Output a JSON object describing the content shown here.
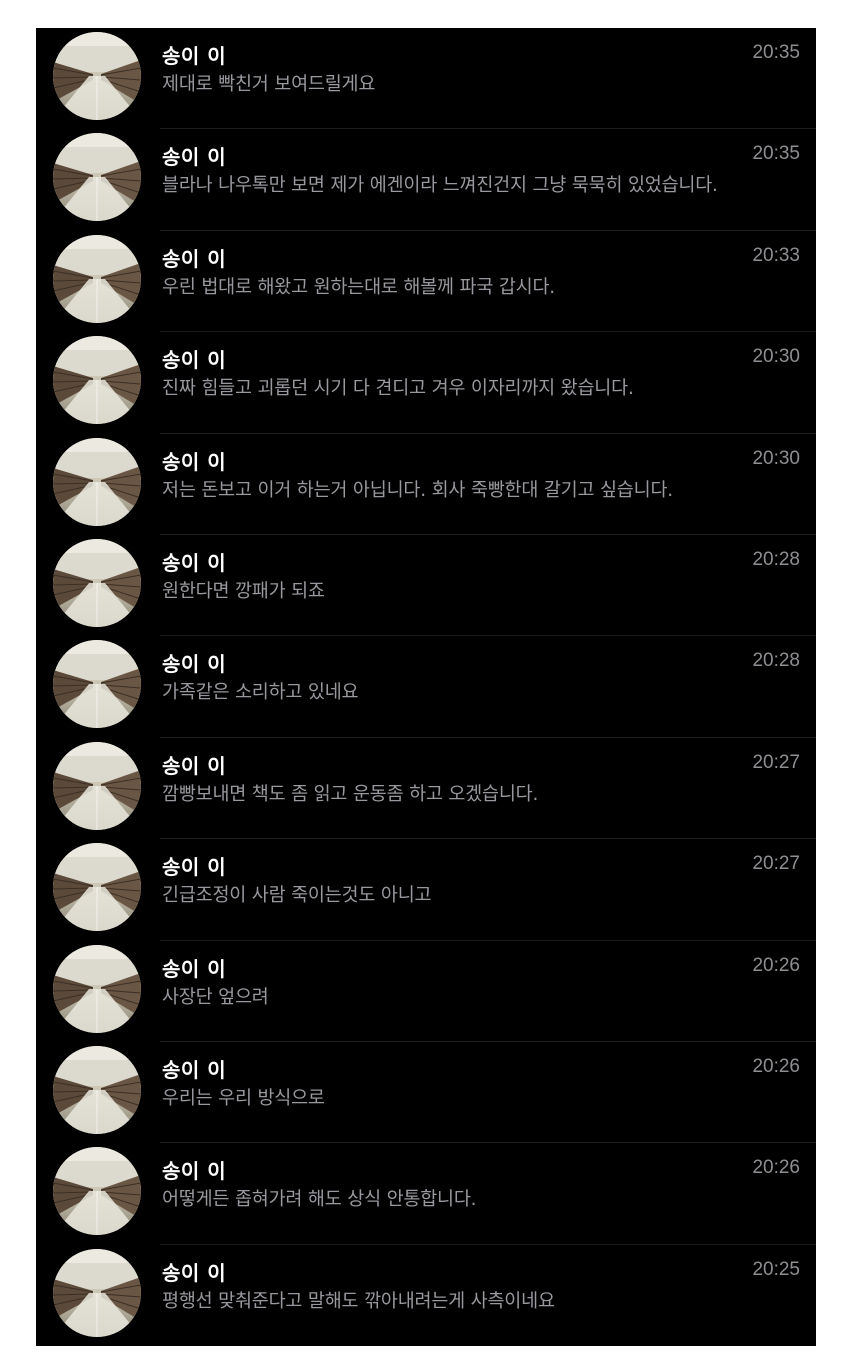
{
  "messages": [
    {
      "sender": "송이 이",
      "time": "20:35",
      "text": "제대로 빡친거 보여드릴게요"
    },
    {
      "sender": "송이 이",
      "time": "20:35",
      "text": "블라나 나우톡만 보면 제가 에겐이라 느껴진건지 그냥 묵묵히 있었습니다."
    },
    {
      "sender": "송이 이",
      "time": "20:33",
      "text": "우린 법대로 해왔고 원하는대로 해볼께 파국 갑시다."
    },
    {
      "sender": "송이 이",
      "time": "20:30",
      "text": "진짜 힘들고 괴롭던 시기 다 견디고 겨우 이자리까지 왔습니다."
    },
    {
      "sender": "송이 이",
      "time": "20:30",
      "text": "저는 돈보고 이거 하는거 아닙니다. 회사 죽빵한대 갈기고 싶습니다."
    },
    {
      "sender": "송이 이",
      "time": "20:28",
      "text": "원한다면 깡패가 되죠"
    },
    {
      "sender": "송이 이",
      "time": "20:28",
      "text": "가족같은 소리하고 있네요"
    },
    {
      "sender": "송이 이",
      "time": "20:27",
      "text": "깜빵보내면 책도 좀 읽고 운동좀 하고 오겠습니다."
    },
    {
      "sender": "송이 이",
      "time": "20:27",
      "text": "긴급조정이 사람 죽이는것도 아니고"
    },
    {
      "sender": "송이 이",
      "time": "20:26",
      "text": "사장단 엎으려"
    },
    {
      "sender": "송이 이",
      "time": "20:26",
      "text": "우리는 우리 방식으로"
    },
    {
      "sender": "송이 이",
      "time": "20:26",
      "text": "어떻게든 좁혀가려 해도 상식 안통합니다."
    },
    {
      "sender": "송이 이",
      "time": "20:25",
      "text": "평행선 맞춰준다고 말해도 깎아내려는게 사측이네요"
    }
  ],
  "colors": {
    "background": "#000000",
    "sender": "#ffffff",
    "message": "#98989e",
    "time": "#8e8e93",
    "divider": "#1c1c1e"
  }
}
